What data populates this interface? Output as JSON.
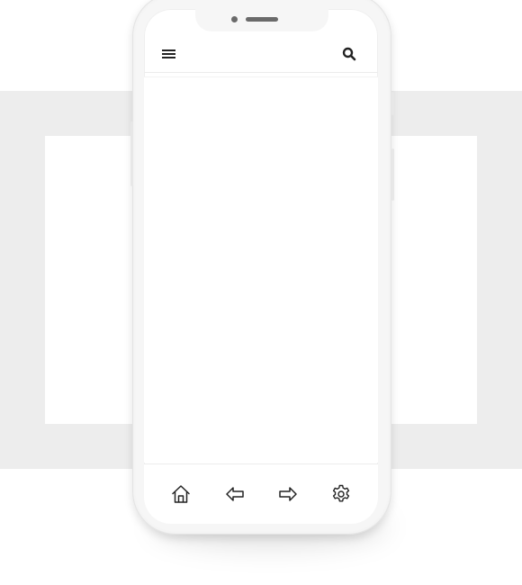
{
  "device": {
    "type": "smartphone mockup",
    "frame_color": "#f6f6f6",
    "screen_color": "#ffffff",
    "backdrop_color": "#ededed"
  },
  "topbar": {
    "left_icon": "menu-icon",
    "right_icon": "search-icon"
  },
  "bottom_nav": {
    "items": [
      {
        "icon": "home-icon"
      },
      {
        "icon": "arrow-left-icon"
      },
      {
        "icon": "arrow-right-icon"
      },
      {
        "icon": "settings-icon"
      }
    ]
  },
  "icon_color": "#222222"
}
